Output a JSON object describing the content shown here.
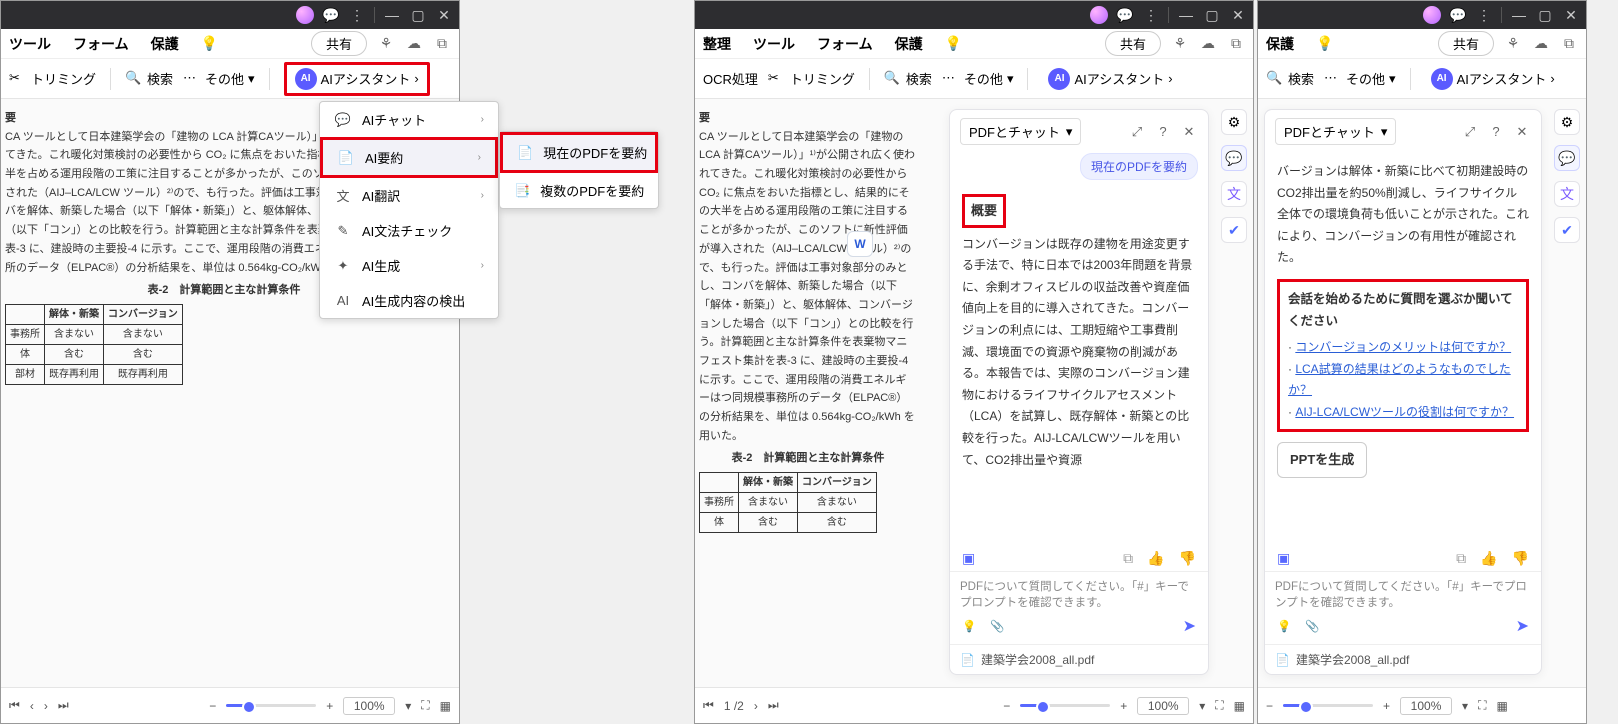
{
  "menu": {
    "tool": "ツール",
    "form": "フォーム",
    "protect": "保護",
    "organize": "整理",
    "share": "共有"
  },
  "toolbar": {
    "trim": "トリミング",
    "search": "検索",
    "other": "その他",
    "ai": "AIアシスタント",
    "ocr": "OCR処理"
  },
  "ai_menu": {
    "chat": "AIチャット",
    "summary": "AI要約",
    "translate": "AI翻訳",
    "grammar": "AI文法チェック",
    "generate": "AI生成",
    "detect": "AI生成内容の検出",
    "sub_current": "現在のPDFを要約",
    "sub_multi": "複数のPDFを要約"
  },
  "doc": {
    "heading": "要",
    "body": "CA ツールとして日本建築学会の「建物の LCA 計算CAツール）」¹⁾が公開され広く使われてきた。これ暖化対策検討の必要性から CO₂ に焦点をおいた指標とし、結果的にその大半を占める運用段階のエ策に注目することが多かったが、このソフトに新性評価が導入された（AIJ–LCA/LCW ツール）²⁾ので、も行った。評価は工事対象部分のみとし、コンバを解体、新築した場合（以下「解体・新築」）と、躯体解体、コンバージョンした場合（以下「コン」）との比較を行う。計算範囲と主な計算条件を表棄物マニフェスト集計を表-3 に、建設時の主要投-4 に示す。ここで、運用段階の消費エネルギーはつ同規模事務所のデータ（ELPAC®）の分析結果を、単位は 0.564kg-CO₂/kWh を用いた。",
    "table_caption": "表-2　計算範囲と主な計算条件",
    "th_a": "解体・新築",
    "th_b": "コンバージョン",
    "r1": "事務所",
    "r1a": "含まない",
    "r1b": "含まない",
    "r2": "体",
    "r2a": "含む",
    "r2b": "含む",
    "r3": "部材",
    "r3a": "既存再利用",
    "r3b": "既存再利用"
  },
  "status": {
    "page": "1 /2",
    "zoom": "100%"
  },
  "ai_panel": {
    "title": "PDFとチャット",
    "pill": "現在のPDFを要約",
    "overview": "概要",
    "summary_text": "コンバージョンは既存の建物を用途変更する手法で、特に日本では2003年問題を背景に、余剰オフィスビルの収益改善や資産価値向上を目的に導入されてきた。コンバージョンの利点には、工期短縮や工事費削減、環境面での資源や廃棄物の削減がある。本報告では、実際のコンバージョン建物におけるライフサイクルアセスメント（LCA）を試算し、既存解体・新築との比較を行った。AIJ-LCA/LCWツールを用いて、CO2排出量や資源",
    "summary_more": "バージョンは解体・新築に比べて初期建設時のCO2排出量を約50%削減し、ライフサイクル全体での環境負荷も低いことが示された。これにより、コンバージョンの有用性が確認された。",
    "ask_prompt": "会話を始めるために質問を選ぶか聞いてください",
    "q1": "コンバージョンのメリットは何ですか？",
    "q2": "LCA試算の結果はどのようなものでしたか？",
    "q3": "AIJ-LCA/LCWツールの役割は何ですか？",
    "ppt": "PPTを生成",
    "placeholder": "PDFについて質問してください。「#」キーでプロンプトを確認できます。",
    "filename": "建築学会2008_all.pdf"
  }
}
